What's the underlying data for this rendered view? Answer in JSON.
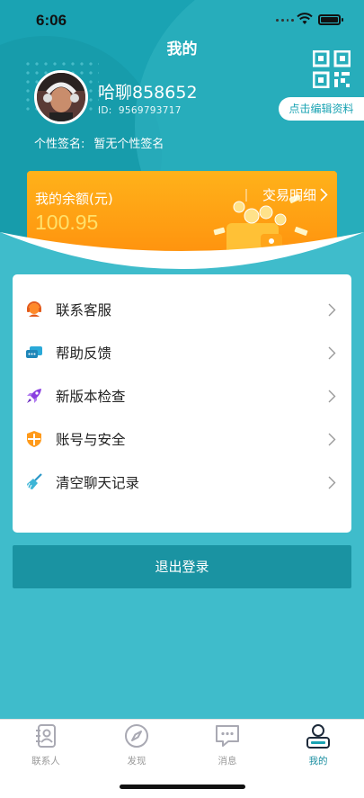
{
  "status_bar": {
    "time": "6:06"
  },
  "header": {
    "title": "我的",
    "edit_profile_label": "点击编辑资料",
    "qr_icon": "qr-code-icon"
  },
  "profile": {
    "nickname": "哈聊858652",
    "id_label": "ID:",
    "id_value": "9569793717",
    "signature_label": "个性签名:",
    "signature_value": "暂无个性签名"
  },
  "wallet": {
    "label": "我的余额(元)",
    "amount": "100.95",
    "detail_label": "交易明细"
  },
  "menu": [
    {
      "label": "联系客服",
      "icon": "customer-service-icon"
    },
    {
      "label": "帮助反馈",
      "icon": "feedback-icon"
    },
    {
      "label": "新版本检查",
      "icon": "rocket-icon"
    },
    {
      "label": "账号与安全",
      "icon": "shield-icon"
    },
    {
      "label": "清空聊天记录",
      "icon": "broom-icon"
    }
  ],
  "logout_label": "退出登录",
  "tabs": [
    {
      "label": "联系人",
      "icon": "contacts-icon",
      "active": false
    },
    {
      "label": "发现",
      "icon": "compass-icon",
      "active": false
    },
    {
      "label": "消息",
      "icon": "message-icon",
      "active": false
    },
    {
      "label": "我的",
      "icon": "profile-icon",
      "active": true
    }
  ],
  "colors": {
    "brand_teal": "#1aa3b3",
    "background": "#3fbccb",
    "wallet_orange": "#ff9a10",
    "amount_yellow": "#ffe06a",
    "active_tab": "#1a8ea0"
  }
}
